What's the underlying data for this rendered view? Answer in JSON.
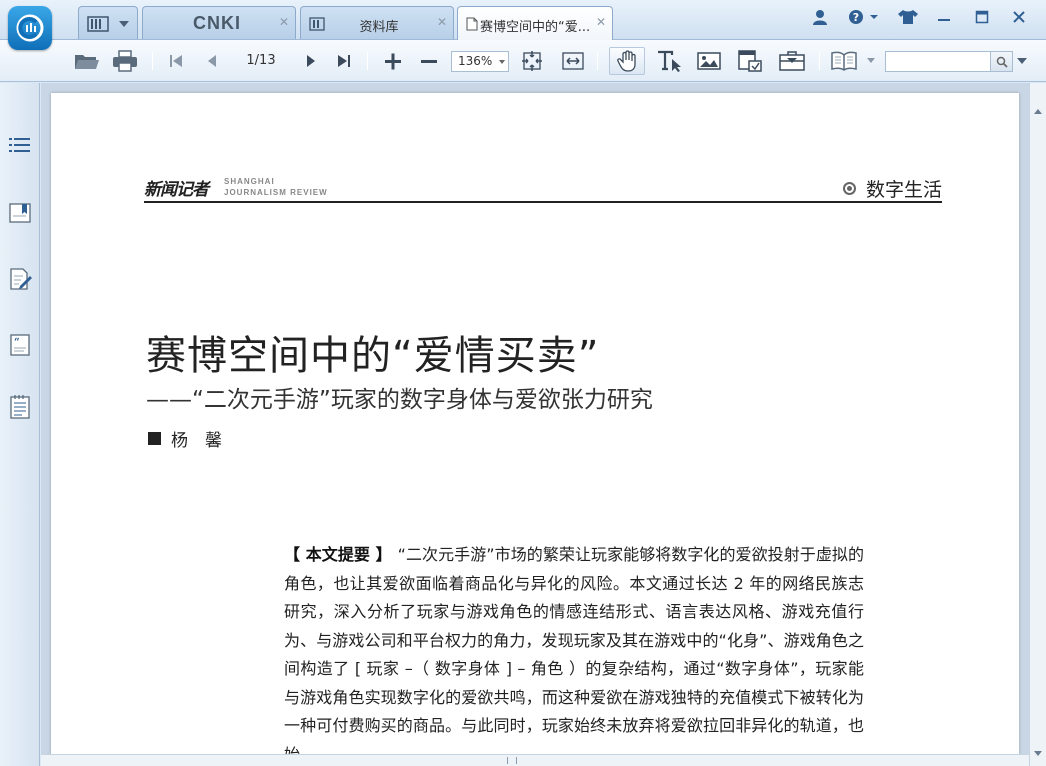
{
  "app": {
    "tabs": [
      {
        "label": "",
        "kind": "library-menu"
      },
      {
        "label": "CNKI",
        "kind": "cnki-home"
      },
      {
        "label": "资料库",
        "kind": "library"
      },
      {
        "label": "赛博空间中的“爱...",
        "kind": "document",
        "active": true
      }
    ]
  },
  "toolbar": {
    "page_indicator": "1/13",
    "zoom": "136%",
    "search_placeholder": ""
  },
  "document": {
    "journal_logo_cn": "新闻记者",
    "journal_logo_en_line1": "SHANGHAI",
    "journal_logo_en_line2": "JOURNALISM REVIEW",
    "section": "数字生活",
    "title": "赛博空间中的“爱情买卖”",
    "subtitle": "——“二次元手游”玩家的数字身体与爱欲张力研究",
    "author": "杨　馨",
    "abstract_label": "【 本文提要 】",
    "abstract_text": "“二次元手游”市场的繁荣让玩家能够将数字化的爱欲投射于虚拟的角色，也让其爱欲面临着商品化与异化的风险。本文通过长达 2 年的网络民族志研究，深入分析了玩家与游戏角色的情感连结形式、语言表达风格、游戏充值行为、与游戏公司和平台权力的角力，发现玩家及其在游戏中的“化身”、游戏角色之间构造了 [ 玩家 –（ 数字身体 ] – 角色 ）的复杂结构，通过“数字身体”，玩家能与游戏角色实现数字化的爱欲共鸣，而这种爱欲在游戏独特的充值模式下被转化为一种可付费购买的商品。与此同时，玩家始终未放弃将爱欲拉回非异化的轨道，也始"
  },
  "colors": {
    "accent": "#1a7fc9",
    "titlebar": "#cfe0f1",
    "page_bg": "#ffffff",
    "text": "#222222"
  }
}
